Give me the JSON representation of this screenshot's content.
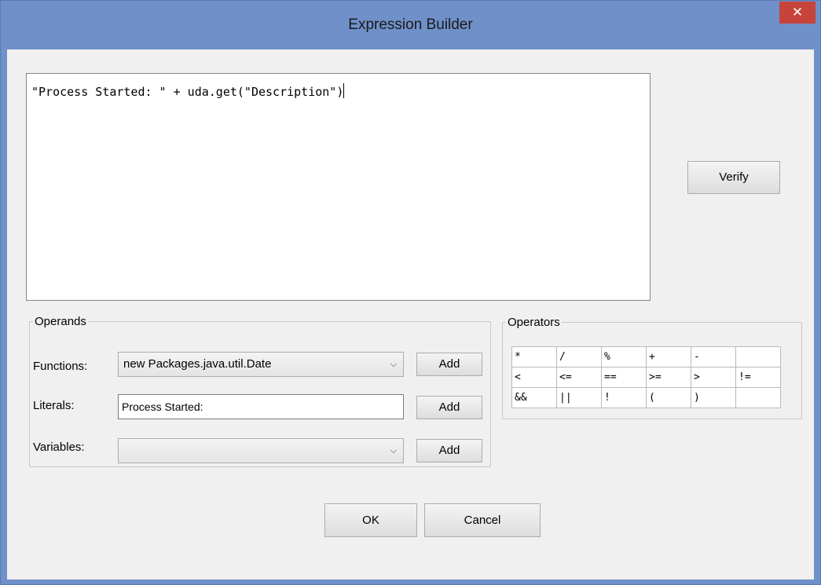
{
  "window": {
    "title": "Expression Builder",
    "close_glyph": "✕"
  },
  "editor": {
    "text": "\"Process Started: \" + uda.get(\"Description\")"
  },
  "verify_label": "Verify",
  "operands": {
    "legend": "Operands",
    "functions": {
      "label": "Functions:",
      "value": "new Packages.java.util.Date",
      "add_label": "Add"
    },
    "literals": {
      "label": "Literals:",
      "value": "Process Started:",
      "add_label": "Add"
    },
    "variables": {
      "label": "Variables:",
      "value": "",
      "add_label": "Add"
    }
  },
  "operators": {
    "legend": "Operators",
    "rows": [
      [
        "*",
        "/",
        "%",
        "+",
        "-",
        ""
      ],
      [
        "<",
        "<=",
        "==",
        ">=",
        ">",
        "!="
      ],
      [
        "&&",
        "||",
        "!",
        "(",
        ")",
        ""
      ]
    ]
  },
  "buttons": {
    "ok": "OK",
    "cancel": "Cancel"
  }
}
